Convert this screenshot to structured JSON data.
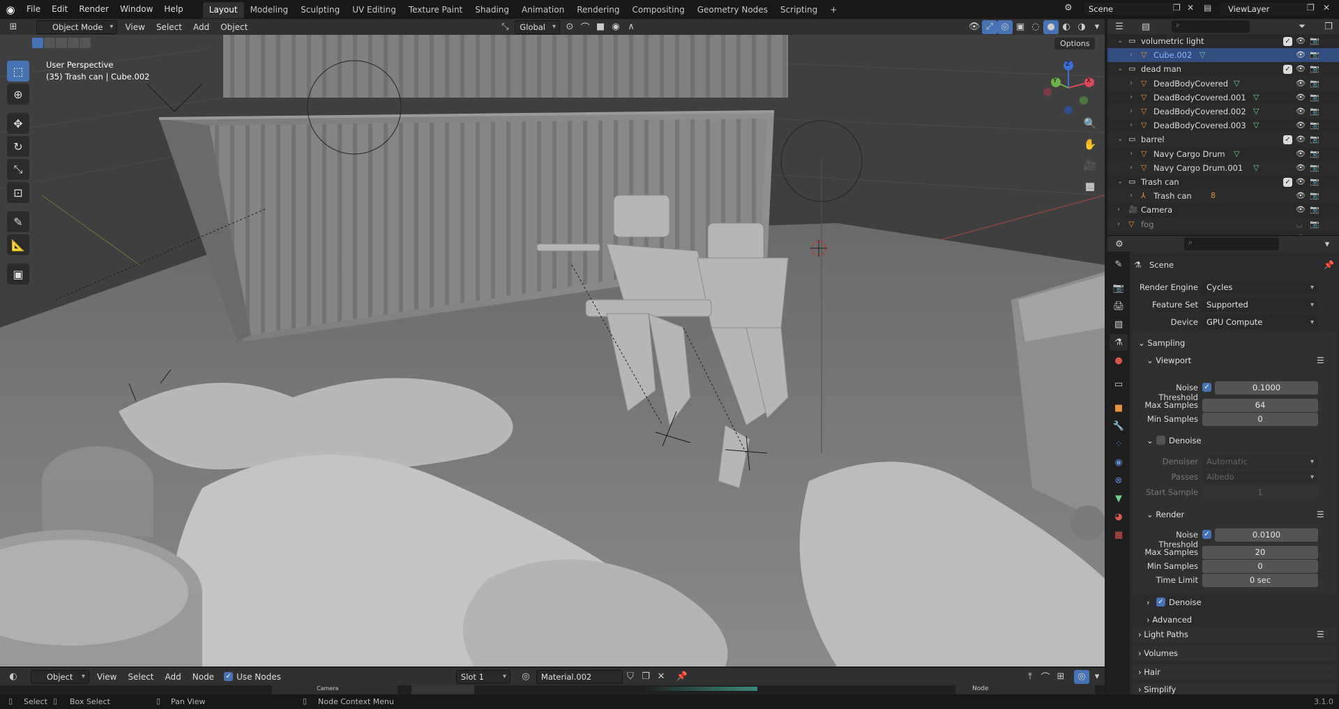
{
  "topbar": {
    "menus": [
      "File",
      "Edit",
      "Render",
      "Window",
      "Help"
    ],
    "workspaces": [
      "Layout",
      "Modeling",
      "Sculpting",
      "UV Editing",
      "Texture Paint",
      "Shading",
      "Animation",
      "Rendering",
      "Compositing",
      "Geometry Nodes",
      "Scripting"
    ],
    "active_workspace": "Layout",
    "add_workspace": "+",
    "scene": "Scene",
    "view_layer": "ViewLayer"
  },
  "viewport_header": {
    "mode": "Object Mode",
    "menus": [
      "View",
      "Select",
      "Add",
      "Object"
    ],
    "orientation": "Global",
    "options": "Options"
  },
  "viewport": {
    "perspective": "User Perspective",
    "context": "(35) Trash can | Cube.002",
    "gizmo_axes": [
      "X",
      "Y",
      "Z"
    ]
  },
  "tools": [
    "select-box-icon",
    "cursor-icon",
    "move-icon",
    "rotate-icon",
    "scale-icon",
    "transform-icon",
    "annotate-icon",
    "measure-icon",
    "add-cube-icon"
  ],
  "outliner": {
    "rows": [
      {
        "name": "volumetric light",
        "type": "collection",
        "indent": 0
      },
      {
        "name": "Cube.002",
        "type": "object",
        "indent": 1,
        "selected": true
      },
      {
        "name": "dead man",
        "type": "collection",
        "indent": 0
      },
      {
        "name": "DeadBodyCovered",
        "type": "object",
        "indent": 1
      },
      {
        "name": "DeadBodyCovered.001",
        "type": "object",
        "indent": 1
      },
      {
        "name": "DeadBodyCovered.002",
        "type": "object",
        "indent": 1
      },
      {
        "name": "DeadBodyCovered.003",
        "type": "object",
        "indent": 1
      },
      {
        "name": "barrel",
        "type": "collection",
        "indent": 0
      },
      {
        "name": "Navy Cargo Drum",
        "type": "object",
        "indent": 1
      },
      {
        "name": "Navy Cargo Drum.001",
        "type": "object",
        "indent": 1
      },
      {
        "name": "Trash can",
        "type": "collection",
        "indent": 0
      },
      {
        "name": "Trash can",
        "type": "armature",
        "indent": 1,
        "badge": "8"
      },
      {
        "name": "Camera",
        "type": "camera",
        "indent": 0
      },
      {
        "name": "fog",
        "type": "object",
        "indent": 0,
        "dim": true
      },
      {
        "name": "Plane",
        "type": "object",
        "indent": 0
      }
    ]
  },
  "properties": {
    "context": "Scene",
    "render_engine_label": "Render Engine",
    "render_engine": "Cycles",
    "feature_set_label": "Feature Set",
    "feature_set": "Supported",
    "device_label": "Device",
    "device": "GPU Compute",
    "sampling": "Sampling",
    "viewport": "Viewport",
    "noise_threshold_label": "Noise Threshold",
    "viewport_noise_threshold": "0.1000",
    "max_samples_label": "Max Samples",
    "viewport_max_samples": "64",
    "min_samples_label": "Min Samples",
    "viewport_min_samples": "0",
    "denoise": "Denoise",
    "denoiser_label": "Denoiser",
    "denoiser": "Automatic",
    "passes_label": "Passes",
    "passes": "Albedo",
    "start_sample_label": "Start Sample",
    "start_sample": "1",
    "render": "Render",
    "render_noise_threshold": "0.0100",
    "render_max_samples": "20",
    "render_min_samples": "0",
    "time_limit_label": "Time Limit",
    "time_limit": "0 sec",
    "advanced": "Advanced",
    "light_paths": "Light Paths",
    "volumes": "Volumes",
    "hair": "Hair",
    "simplify": "Simplify"
  },
  "node_header": {
    "type": "Object",
    "menus": [
      "View",
      "Select",
      "Add",
      "Node"
    ],
    "use_nodes": "Use Nodes",
    "slot": "Slot 1",
    "material": "Material.002",
    "camera_strip": "Camera",
    "node_label": "Node"
  },
  "status": {
    "select": "Select",
    "box_select": "Box Select",
    "pan_view": "Pan View",
    "node_context_menu": "Node Context Menu",
    "version": "3.1.0"
  },
  "colors": {
    "accent": "#4772b3",
    "selection": "#334d80",
    "object_orange": "#e8923a",
    "mesh_green": "#6fcf8f"
  }
}
